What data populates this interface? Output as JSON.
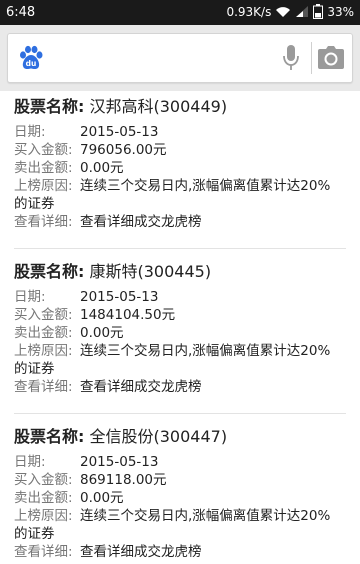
{
  "status_bar": {
    "time": "6:48",
    "network_speed": "0.93K/s",
    "battery": "33%"
  },
  "records": [
    {
      "name_label": "股票名称:",
      "name_value": "汉邦高科(300449)",
      "date_label": "日期:",
      "date_value": "2015-05-13",
      "buy_label": "买入金额:",
      "buy_value": "796056.00元",
      "sell_label": "卖出金额:",
      "sell_value": "0.00元",
      "reason_label": "上榜原因:",
      "reason_line1": "连续三个交易日内,涨幅偏离值累计达20%",
      "reason_line2": "的证券",
      "detail_label": "查看详细:",
      "detail_value": "查看详细成交龙虎榜"
    },
    {
      "name_label": "股票名称:",
      "name_value": "康斯特(300445)",
      "date_label": "日期:",
      "date_value": "2015-05-13",
      "buy_label": "买入金额:",
      "buy_value": "1484104.50元",
      "sell_label": "卖出金额:",
      "sell_value": "0.00元",
      "reason_label": "上榜原因:",
      "reason_line1": "连续三个交易日内,涨幅偏离值累计达20%",
      "reason_line2": "的证券",
      "detail_label": "查看详细:",
      "detail_value": "查看详细成交龙虎榜"
    },
    {
      "name_label": "股票名称:",
      "name_value": "全信股份(300447)",
      "date_label": "日期:",
      "date_value": "2015-05-13",
      "buy_label": "买入金额:",
      "buy_value": "869118.00元",
      "sell_label": "卖出金额:",
      "sell_value": "0.00元",
      "reason_label": "上榜原因:",
      "reason_line1": "连续三个交易日内,涨幅偏离值累计达20%",
      "reason_line2": "的证券",
      "detail_label": "查看详细:",
      "detail_value": "查看详细成交龙虎榜"
    }
  ],
  "icons": {
    "logo": "baidu-paw-logo",
    "mic": "microphone-icon",
    "camera": "camera-icon"
  },
  "colors": {
    "brand_blue": "#2f6fe0",
    "icon_gray": "#9a9a9a"
  }
}
